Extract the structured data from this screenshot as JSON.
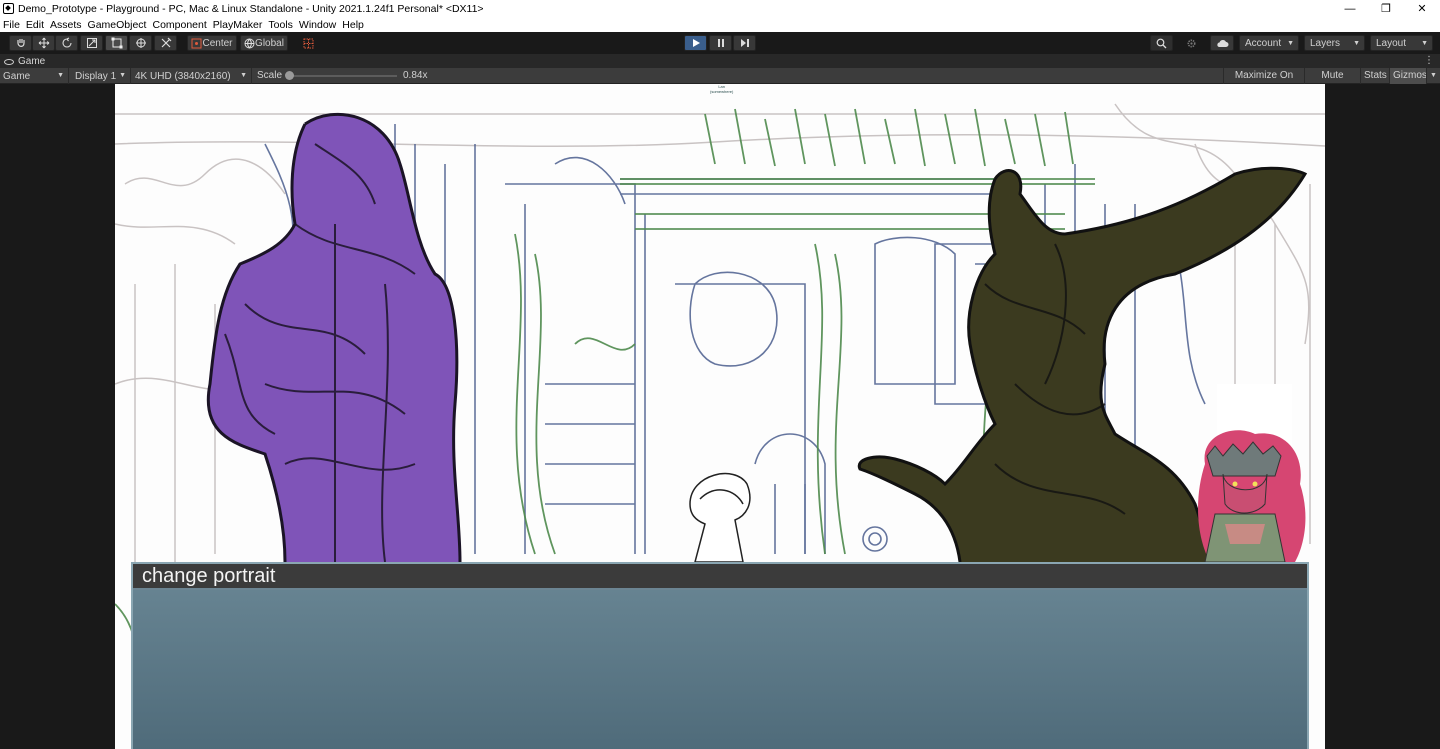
{
  "window": {
    "title": "Demo_Prototype - Playground - PC, Mac & Linux Standalone - Unity 2021.1.24f1 Personal* <DX11>",
    "controls": {
      "minimize": "—",
      "restore": "❐",
      "close": "✕"
    }
  },
  "menu": [
    "File",
    "Edit",
    "Assets",
    "GameObject",
    "Component",
    "PlayMaker",
    "Tools",
    "Window",
    "Help"
  ],
  "toolbar": {
    "tools": [
      "hand-tool",
      "move-tool",
      "rotate-tool",
      "scale-tool",
      "rect-tool",
      "transform-tool",
      "custom-tool"
    ],
    "pivot_label": "Center",
    "space_label": "Global",
    "account_label": "Account",
    "layers_label": "Layers",
    "layout_label": "Layout"
  },
  "tab": {
    "label": "Game"
  },
  "gamebar": {
    "view_mode": "Game",
    "display": "Display 1",
    "resolution": "4K UHD (3840x2160)",
    "scale_label": "Scale",
    "scale_value": "0.84x",
    "maximize_on_play": "Maximize On Play",
    "mute_audio": "Mute Audio",
    "stats": "Stats",
    "gizmos": "Gizmos"
  },
  "scene": {
    "top_label_line1": "Lan",
    "top_label_line2": "(somewhere)"
  },
  "dialog": {
    "title": "change portrait"
  },
  "colors": {
    "purple_character": "#7f54b8",
    "dark_character": "#3b3a1f",
    "dialog_header": "#3b3b3b",
    "dialog_body": "#5f7c8b",
    "play_active": "#3a5e8c"
  }
}
